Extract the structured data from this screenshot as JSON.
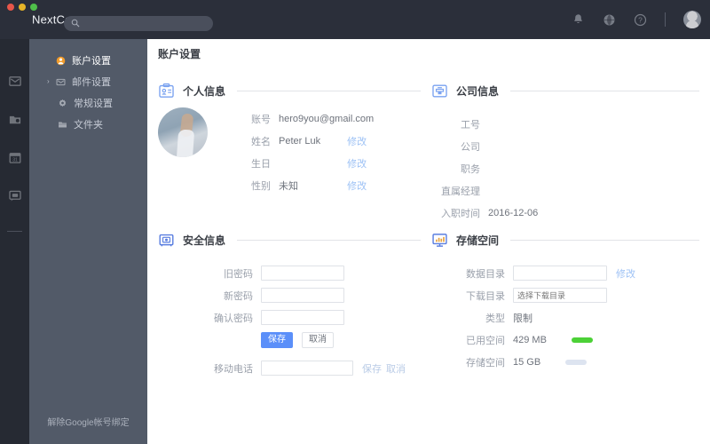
{
  "window": {
    "brand": "NextCont",
    "search_placeholder": "",
    "traffic_lights": [
      "close",
      "minimize",
      "zoom"
    ],
    "icons": [
      "bell-icon",
      "globe-icon",
      "help-icon",
      "avatar"
    ]
  },
  "rail": {
    "items": [
      {
        "name": "mail-icon"
      },
      {
        "name": "contacts-icon"
      },
      {
        "name": "calendar-icon"
      },
      {
        "name": "chat-icon"
      }
    ]
  },
  "sidebar": {
    "items": [
      {
        "label": "账户设置",
        "icon": "user-settings-icon",
        "level": 1,
        "active": true,
        "caret": ""
      },
      {
        "label": "邮件设置",
        "icon": "mail-settings-icon",
        "level": 1,
        "active": false,
        "caret": "›"
      },
      {
        "label": "常规设置",
        "icon": "gear-icon",
        "level": 2,
        "active": false,
        "caret": ""
      },
      {
        "label": "文件夹",
        "icon": "folder-icon",
        "level": 2,
        "active": false,
        "caret": ""
      }
    ],
    "unbind_label": "解除Google帐号绑定"
  },
  "page": {
    "title": "账户设置"
  },
  "personal": {
    "title": "个人信息",
    "icon": "id-card-icon",
    "rows": [
      {
        "label": "账号",
        "value": "hero9you@gmail.com",
        "link": ""
      },
      {
        "label": "姓名",
        "value": "Peter Luk",
        "link": "修改"
      },
      {
        "label": "生日",
        "value": "",
        "link": "修改"
      },
      {
        "label": "性别",
        "value": "未知",
        "link": "修改"
      }
    ]
  },
  "company": {
    "title": "公司信息",
    "icon": "company-badge-icon",
    "rows": [
      {
        "label": "工号",
        "value": ""
      },
      {
        "label": "公司",
        "value": ""
      },
      {
        "label": "职务",
        "value": ""
      },
      {
        "label": "直属经理",
        "value": ""
      },
      {
        "label": "入职时间",
        "value": "2016-12-06"
      }
    ]
  },
  "security": {
    "title": "安全信息",
    "icon": "safe-vault-icon",
    "old_password": {
      "label": "旧密码",
      "value": "",
      "placeholder": ""
    },
    "new_password": {
      "label": "新密码",
      "value": "",
      "placeholder": ""
    },
    "confirm_password": {
      "label": "确认密码",
      "value": "",
      "placeholder": ""
    },
    "save_label": "保存",
    "cancel_label": "取消",
    "phone": {
      "label": "移动电话",
      "value": "",
      "placeholder": ""
    },
    "phone_save_label": "保存",
    "phone_cancel_label": "取消"
  },
  "storage": {
    "title": "存储空间",
    "icon": "monitor-chart-icon",
    "data_dir": {
      "label": "数据目录",
      "value": "",
      "placeholder": "",
      "link": "修改"
    },
    "download_dir": {
      "label": "下载目录",
      "value": "",
      "placeholder": "选择下载目录"
    },
    "type": {
      "label": "类型",
      "value": "限制"
    },
    "used": {
      "label": "已用空间",
      "value": "429 MB",
      "bar_color": "#4cd137"
    },
    "total": {
      "label": "存储空间",
      "value": "15 GB",
      "bar_color": "#dde4f0"
    }
  },
  "colors": {
    "titlebar": "#2b2f3a",
    "rail": "#262a33",
    "sidebar": "#525a68",
    "accent": "#5b8ff9",
    "link": "#9ec2f5"
  }
}
